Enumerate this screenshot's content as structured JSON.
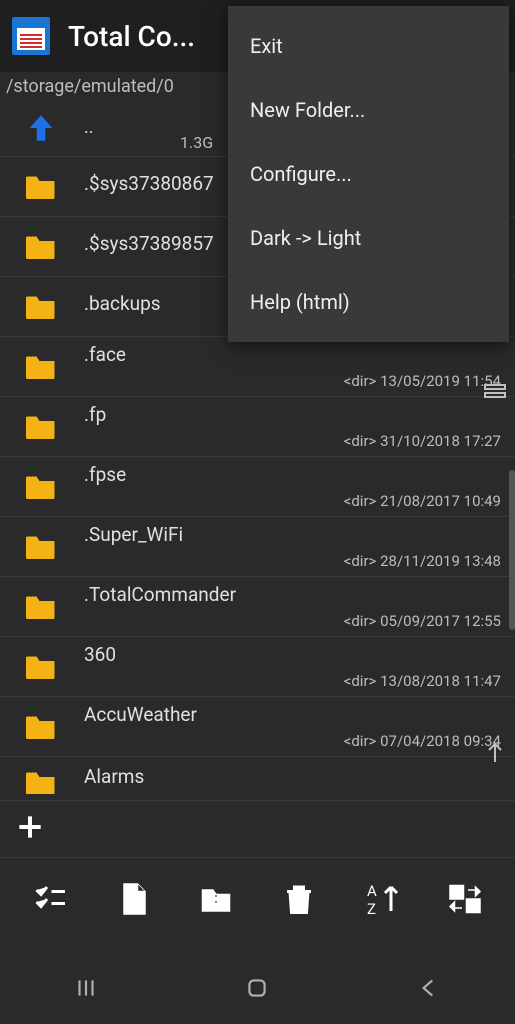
{
  "header": {
    "title": "Total Co..."
  },
  "path": "/storage/emulated/0",
  "up": {
    "label": "..",
    "size": "1.3G"
  },
  "menu": {
    "items": [
      {
        "label": "Exit"
      },
      {
        "label": "New Folder..."
      },
      {
        "label": "Configure..."
      },
      {
        "label": "Dark -> Light"
      },
      {
        "label": "Help (html)"
      }
    ]
  },
  "rows": [
    {
      "name": ".$sys37380867",
      "meta": ""
    },
    {
      "name": ".$sys37389857",
      "meta": ""
    },
    {
      "name": ".backups",
      "meta": ""
    },
    {
      "name": ".face",
      "meta": "<dir>  13/05/2019  11:54"
    },
    {
      "name": ".fp",
      "meta": "<dir>  31/10/2018  17:27"
    },
    {
      "name": ".fpse",
      "meta": "<dir>  21/08/2017  10:49"
    },
    {
      "name": ".Super_WiFi",
      "meta": "<dir>  28/11/2019  13:48"
    },
    {
      "name": ".TotalCommander",
      "meta": "<dir>  05/09/2017  12:55"
    },
    {
      "name": "360",
      "meta": "<dir>  13/08/2018  11:47"
    },
    {
      "name": "AccuWeather",
      "meta": "<dir>  07/04/2018  09:34"
    },
    {
      "name": "Alarms",
      "meta": ""
    }
  ],
  "icons": {
    "drawer": "drawer",
    "up_arrow": "up",
    "select": "select",
    "file": "file",
    "zip": "zip",
    "delete": "delete",
    "sort": "sort",
    "swap": "swap",
    "plus": "plus"
  }
}
